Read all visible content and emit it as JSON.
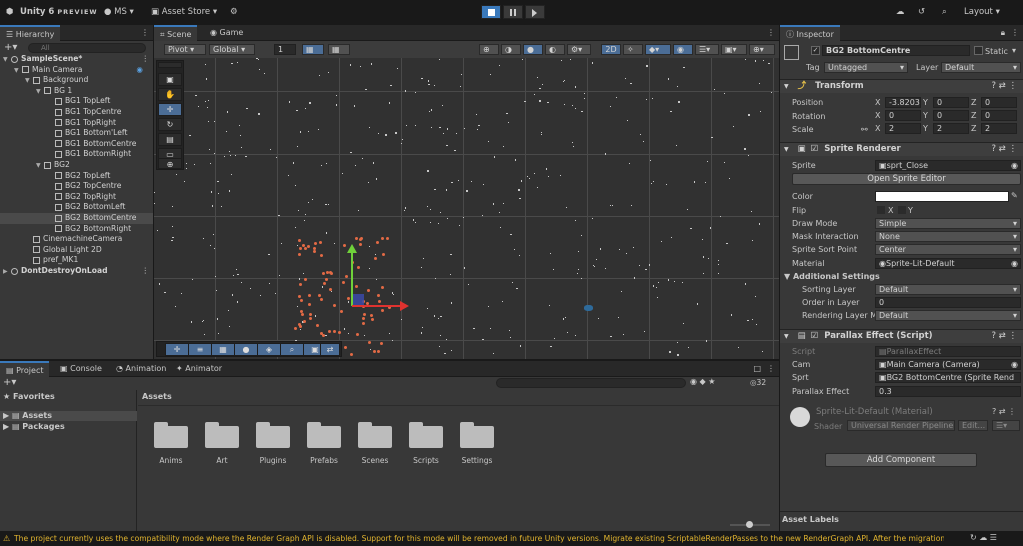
{
  "topbar": {
    "app_label": "Unity 6",
    "preview": "PREVIEW",
    "account": "MS",
    "store": "Asset Store",
    "layout": "Layout"
  },
  "hierarchy": {
    "tab": "Hierarchy",
    "search_placeholder": "All",
    "rows": [
      {
        "label": "SampleScene*",
        "depth": 0,
        "kind": "scene"
      },
      {
        "label": "Main Camera",
        "depth": 1,
        "kind": "obj"
      },
      {
        "label": "Background",
        "depth": 2,
        "kind": "obj"
      },
      {
        "label": "BG 1",
        "depth": 3,
        "kind": "obj"
      },
      {
        "label": "BG1 TopLeft",
        "depth": 4,
        "kind": "obj"
      },
      {
        "label": "BG1 TopCentre",
        "depth": 4,
        "kind": "obj"
      },
      {
        "label": "BG1 TopRight",
        "depth": 4,
        "kind": "obj"
      },
      {
        "label": "BG1 Bottom'Left",
        "depth": 4,
        "kind": "obj"
      },
      {
        "label": "BG1 BottomCentre",
        "depth": 4,
        "kind": "obj"
      },
      {
        "label": "BG1 BottomRight",
        "depth": 4,
        "kind": "obj"
      },
      {
        "label": "BG2",
        "depth": 3,
        "kind": "obj"
      },
      {
        "label": "BG2 TopLeft",
        "depth": 4,
        "kind": "obj"
      },
      {
        "label": "BG2 TopCentre",
        "depth": 4,
        "kind": "obj"
      },
      {
        "label": "BG2 TopRight",
        "depth": 4,
        "kind": "obj"
      },
      {
        "label": "BG2 BottomLeft",
        "depth": 4,
        "kind": "obj"
      },
      {
        "label": "BG2 BottomCentre",
        "depth": 4,
        "kind": "obj",
        "selected": true
      },
      {
        "label": "BG2 BottomRight",
        "depth": 4,
        "kind": "obj"
      },
      {
        "label": "CinemachineCamera",
        "depth": 2,
        "kind": "obj"
      },
      {
        "label": "Global Light 2D",
        "depth": 2,
        "kind": "obj"
      },
      {
        "label": "pref_MK1",
        "depth": 2,
        "kind": "obj"
      },
      {
        "label": "DontDestroyOnLoad",
        "depth": 0,
        "kind": "scene"
      }
    ]
  },
  "scene": {
    "tab_scene": "Scene",
    "tab_game": "Game",
    "pivot": "Pivot",
    "global": "Global",
    "grid_size": "1",
    "mode2d": "2D"
  },
  "inspector": {
    "tab": "Inspector",
    "object_name": "BG2 BottomCentre",
    "static_label": "Static",
    "tag_label": "Tag",
    "tag_value": "Untagged",
    "layer_label": "Layer",
    "layer_value": "Default",
    "transform": {
      "title": "Transform",
      "position_label": "Position",
      "rotation_label": "Rotation",
      "scale_label": "Scale",
      "pos": [
        "-3.8203",
        "0",
        "0"
      ],
      "rot": [
        "0",
        "0",
        "0"
      ],
      "scale": [
        "2",
        "2",
        "2"
      ]
    },
    "sprite_renderer": {
      "title": "Sprite Renderer",
      "sprite_label": "Sprite",
      "sprite_value": "sprt_Close",
      "open_editor": "Open Sprite Editor",
      "color_label": "Color",
      "flip_label": "Flip",
      "flip_x": "X",
      "flip_y": "Y",
      "draw_mode_label": "Draw Mode",
      "draw_mode": "Simple",
      "mask_label": "Mask Interaction",
      "mask": "None",
      "sort_point_label": "Sprite Sort Point",
      "sort_point": "Center",
      "material_label": "Material",
      "material": "Sprite-Lit-Default",
      "additional": "Additional Settings",
      "sorting_layer_label": "Sorting Layer",
      "sorting_layer": "Default",
      "order_label": "Order in Layer",
      "order": "0",
      "rendering_layer_label": "Rendering Layer M",
      "rendering_layer": "Default"
    },
    "parallax": {
      "title": "Parallax Effect (Script)",
      "script_label": "Script",
      "script": "ParallaxEffect",
      "cam_label": "Cam",
      "cam": "Main Camera (Camera)",
      "sprt_label": "Sprt",
      "sprt": "BG2 BottomCentre (Sprite Rend",
      "effect_label": "Parallax Effect",
      "effect": "0.3"
    },
    "material_block": {
      "name": "Sprite-Lit-Default (Material)",
      "shader_label": "Shader",
      "shader": "Universal Render Pipeline",
      "edit": "Edit..."
    },
    "add_component": "Add Component",
    "asset_labels": "Asset Labels"
  },
  "project": {
    "tabs": [
      "Project",
      "Console",
      "Animation",
      "Animator"
    ],
    "favorites": "Favorites",
    "assets": "Assets",
    "packages": "Packages",
    "breadcrumb": "Assets",
    "count": "32",
    "folders": [
      "Anims",
      "Art",
      "Plugins",
      "Prefabs",
      "Scenes",
      "Scripts",
      "Settings"
    ]
  },
  "status": {
    "message": "The project currently uses the compatibility mode where the Render Graph API is disabled. Support for this mode will be removed in future Unity versions. Migrate existing ScriptableRenderPasses to the new RenderGraph API. After the migration, c"
  },
  "colors": {
    "accent": "#3a79bb",
    "warning": "#e2b52f",
    "particles": "#e26a45"
  }
}
